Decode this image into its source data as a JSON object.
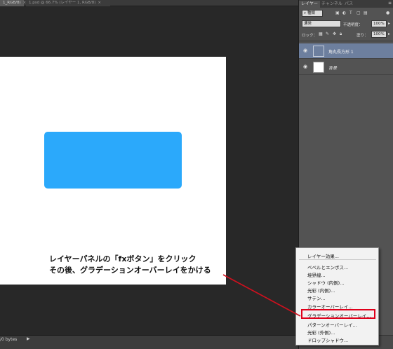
{
  "document": {
    "tab_active_label": "1_RGB/8)",
    "tab_second_label": "1.psd @ 66.7% (レイヤー 1, RGB/8)",
    "close_glyph": "×"
  },
  "annotation": {
    "line1": "レイヤーパネルの「fxボタン」をクリック",
    "line2": "その後、グラデーションオーバーレイをかける"
  },
  "status": {
    "doc_size": "/0 bytes",
    "arrow": "▶"
  },
  "panel": {
    "tabs": [
      "レイヤー",
      "チャンネル",
      "パス"
    ],
    "menu_glyph": "≡",
    "kind_label": "種類",
    "blend_mode": "通常",
    "opacity_label": "不透明度：",
    "opacity_value": "100%",
    "lock_label": "ロック：",
    "fill_label": "塗り：",
    "fill_value": "100%",
    "layers": [
      {
        "name": "角丸長方形 1",
        "selected": true
      },
      {
        "name": "背景",
        "selected": false
      }
    ]
  },
  "fx_menu": {
    "items": [
      "レイヤー効果...",
      "ベベルとエンボス...",
      "境界線...",
      "シャドウ (内側)...",
      "光彩 (内側)...",
      "サテン...",
      "カラーオーバーレイ...",
      "グラデーションオーバーレイ...",
      "パターンオーバーレイ...",
      "光彩 (外側)...",
      "ドロップシャドウ..."
    ],
    "highlighted_item": "グラデーションオーバーレイ..."
  },
  "colors": {
    "shape_fill": "#2ba9fb",
    "highlight_border": "#e0001b",
    "pointer_line": "#d0101e",
    "selected_layer": "#6d7f9e"
  }
}
